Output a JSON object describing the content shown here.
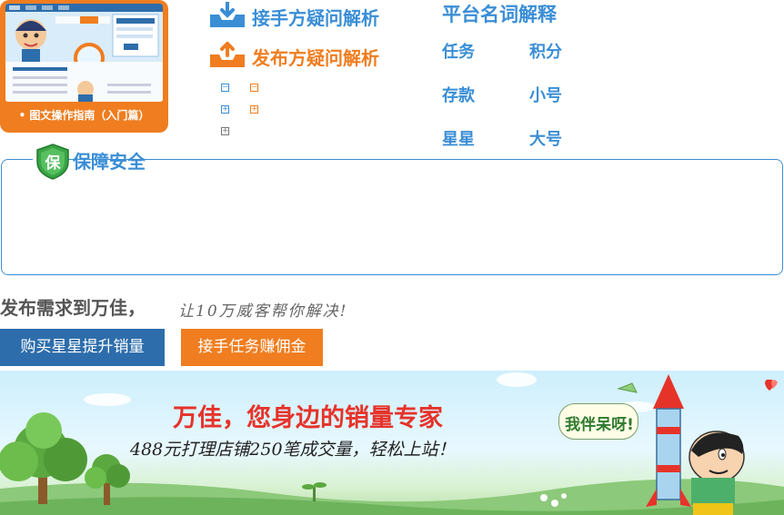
{
  "guide": {
    "caption": "• 图文操作指南（入门篇）"
  },
  "faq": {
    "taker_label": "接手方疑问解析",
    "publisher_label": "发布方疑问解析",
    "taker_color": "#3a8ed6",
    "publisher_color": "#f07d1f"
  },
  "glossary": {
    "title": "平台名词解释",
    "terms": [
      "任务",
      "积分",
      "存款",
      "小号",
      "星星",
      "大号"
    ]
  },
  "security": {
    "badge": "保",
    "title": "保障安全"
  },
  "slogan": {
    "main": "发布需求到万佳，",
    "sub": "让10万威客帮你解决!"
  },
  "buttons": {
    "buy": "购买星星提升销量",
    "take": "接手任务赚佣金"
  },
  "banner": {
    "headline": "万佳，您身边的销量专家",
    "subline": "488元打理店铺250笔成交量，轻松上站！",
    "speech": "我伴呆呀!"
  },
  "colors": {
    "blue": "#3a8ed6",
    "orange": "#f07d1f",
    "dark_blue": "#2d6dab"
  }
}
